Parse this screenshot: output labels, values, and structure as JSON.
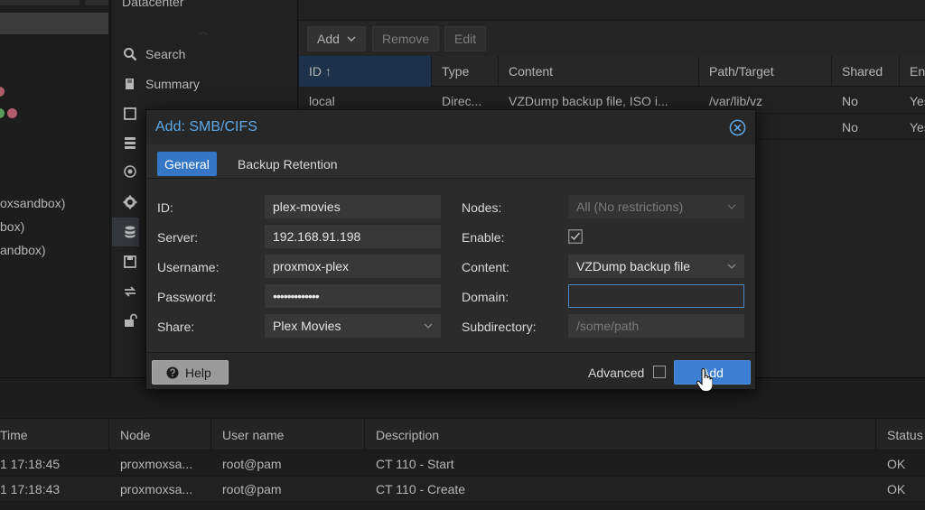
{
  "tree": {
    "nodes": [
      "oxsandbox)",
      "box)",
      "andbox)"
    ]
  },
  "nav": {
    "breadcrumb": "Datacenter",
    "items": [
      {
        "label": "Search",
        "icon": "search-icon"
      },
      {
        "label": "Summary",
        "icon": "book-icon"
      },
      {
        "label": "",
        "icon": "notes-icon"
      },
      {
        "label": "",
        "icon": "cluster-icon"
      },
      {
        "label": "",
        "icon": "ceph-icon"
      },
      {
        "label": "",
        "icon": "gear-icon"
      },
      {
        "label": "",
        "icon": "database-icon"
      },
      {
        "label": "",
        "icon": "save-icon"
      },
      {
        "label": "",
        "icon": "replication-icon"
      },
      {
        "label": "",
        "icon": "unlock-icon"
      }
    ]
  },
  "toolbar": {
    "add_label": "Add",
    "remove_label": "Remove",
    "edit_label": "Edit"
  },
  "storage_grid": {
    "columns": [
      "ID ↑",
      "Type",
      "Content",
      "Path/Target",
      "Shared",
      "En"
    ],
    "rows": [
      [
        "local",
        "Direc...",
        "VZDump backup file, ISO i...",
        "/var/lib/vz",
        "No",
        "Yes"
      ],
      [
        "",
        "",
        "",
        "",
        "No",
        "Yes"
      ]
    ]
  },
  "tasks": {
    "columns": [
      "Time",
      "Node",
      "User name",
      "Description",
      "Status"
    ],
    "rows": [
      [
        "1 17:18:45",
        "proxmoxsa...",
        "root@pam",
        "CT 110 - Start",
        "OK"
      ],
      [
        "1 17:18:43",
        "proxmoxsa...",
        "root@pam",
        "CT 110 - Create",
        "OK"
      ]
    ]
  },
  "dialog": {
    "title": "Add: SMB/CIFS",
    "tabs": [
      "General",
      "Backup Retention"
    ],
    "fields": {
      "id": {
        "label": "ID:",
        "value": "plex-movies"
      },
      "server": {
        "label": "Server:",
        "value": "192.168.91.198"
      },
      "username": {
        "label": "Username:",
        "value": "proxmox-plex"
      },
      "password": {
        "label": "Password:",
        "value": "•••••••••••••"
      },
      "share": {
        "label": "Share:",
        "value": "Plex Movies"
      },
      "nodes": {
        "label": "Nodes:",
        "value": "All (No restrictions)"
      },
      "enable": {
        "label": "Enable:",
        "checked": true
      },
      "content": {
        "label": "Content:",
        "value": "VZDump backup file"
      },
      "domain": {
        "label": "Domain:",
        "value": ""
      },
      "subdirectory": {
        "label": "Subdirectory:",
        "placeholder": "/some/path"
      }
    },
    "help_label": "Help",
    "advanced_label": "Advanced",
    "add_label": "Add"
  },
  "colors": {
    "accent": "#3a7fd1",
    "title_blue": "#5ea8e8",
    "background": "#262626"
  }
}
